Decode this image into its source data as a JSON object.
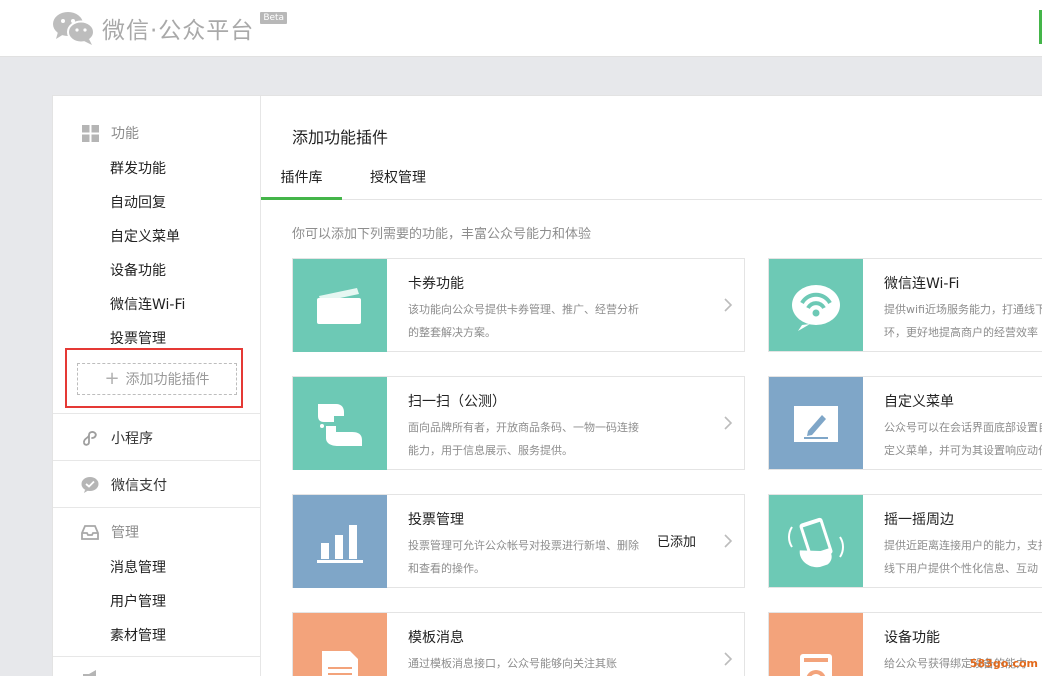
{
  "header": {
    "logo_text": "微信·公众平台",
    "beta": "Beta"
  },
  "sidebar": {
    "function_section": "功能",
    "function_items": [
      "群发功能",
      "自动回复",
      "自定义菜单",
      "设备功能",
      "微信连Wi-Fi",
      "投票管理"
    ],
    "add_plugin": "添加功能插件",
    "mini_program": "小程序",
    "wechat_pay": "微信支付",
    "manage_section": "管理",
    "manage_items": [
      "消息管理",
      "用户管理",
      "素材管理"
    ]
  },
  "main": {
    "title": "添加功能插件",
    "tabs": [
      "插件库",
      "授权管理"
    ],
    "intro": "你可以添加下列需要的功能，丰富公众号能力和体验"
  },
  "cards": [
    {
      "name": "卡券功能",
      "desc": "该功能向公众号提供卡券管理、推广、经营分析的整套解决方案。",
      "status": "",
      "color": "#6dc9b5",
      "icon": "card-icon"
    },
    {
      "name": "微信连Wi-Fi",
      "desc": "提供wifi近场服务能力，打通线下环，更好地提高商户的经营效率",
      "status": "",
      "color": "#6dc9b5",
      "icon": "wifi-icon"
    },
    {
      "name": "扫一扫（公测）",
      "desc": "面向品牌所有者，开放商品条码、一物一码连接能力，用于信息展示、服务提供。",
      "status": "",
      "color": "#6dc9b5",
      "icon": "scan-icon"
    },
    {
      "name": "自定义菜单",
      "desc": "公众号可以在会话界面底部设置自定义菜单，并可为其设置响应动作",
      "status": "",
      "color": "#7fa6c8",
      "icon": "edit-icon"
    },
    {
      "name": "投票管理",
      "desc": "投票管理可允许公众帐号对投票进行新增、删除和查看的操作。",
      "status": "已添加",
      "color": "#7fa6c8",
      "icon": "bar-chart-icon"
    },
    {
      "name": "摇一摇周边",
      "desc": "提供近距离连接用户的能力，支持线下用户提供个性化信息、互动",
      "status": "",
      "color": "#6dc9b5",
      "icon": "shake-icon"
    },
    {
      "name": "模板消息",
      "desc": "通过模板消息接口，公众号能够向关注其账",
      "status": "",
      "color": "#f3a37b",
      "icon": "template-icon"
    },
    {
      "name": "设备功能",
      "desc": "给公众号获得绑定设备的能力",
      "status": "",
      "color": "#f3a37b",
      "icon": "device-icon"
    }
  ],
  "watermark": "583go.com"
}
